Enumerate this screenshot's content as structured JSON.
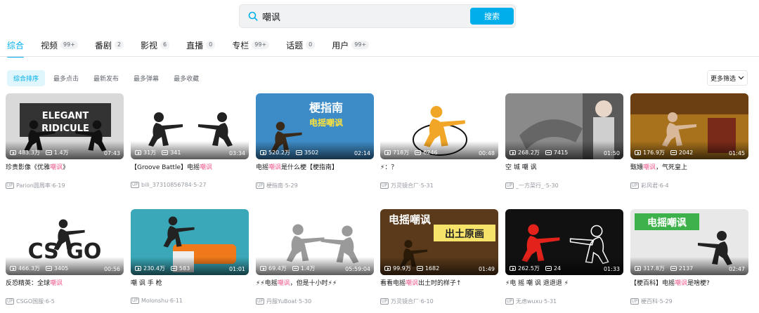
{
  "search": {
    "value": "嘲讽",
    "button_label": "搜索"
  },
  "tabs": [
    {
      "label": "综合",
      "count": null,
      "active": true
    },
    {
      "label": "视频",
      "count": "99+"
    },
    {
      "label": "番剧",
      "count": "2"
    },
    {
      "label": "影视",
      "count": "6"
    },
    {
      "label": "直播",
      "count": "0"
    },
    {
      "label": "专栏",
      "count": "99+"
    },
    {
      "label": "话题",
      "count": "0"
    },
    {
      "label": "用户",
      "count": "99+"
    }
  ],
  "sort": {
    "items": [
      "综合排序",
      "最多点击",
      "最新发布",
      "最多弹幕",
      "最多收藏"
    ],
    "more_filter": "更多筛选"
  },
  "up_badge": "UP",
  "videos": [
    {
      "views": "483.3万",
      "danmaku": "1.4万",
      "duration": "07:43",
      "title_parts": [
        "珍贵影像《优雅",
        "嘲讽",
        "》"
      ],
      "uploader": "Parion圆周率",
      "date": "6-19",
      "thumb_text": "ELEGANT RIDICULE",
      "icon": "thumb-elegant-icon"
    },
    {
      "views": "31万",
      "danmaku": "341",
      "duration": "03:34",
      "title_parts": [
        "【Groove Battle】电摇",
        "嘲讽",
        ""
      ],
      "uploader": "bili_37310856784",
      "date": "5-27",
      "thumb_text": "",
      "icon": "thumb-dancers-icon"
    },
    {
      "views": "520.2万",
      "danmaku": "3502",
      "duration": "02:14",
      "title_parts": [
        "电摇",
        "嘲讽",
        "是什么梗【梗指南】"
      ],
      "uploader": "梗指南",
      "date": "5-29",
      "thumb_text": "梗指南 电摇嘲讽",
      "icon": "thumb-guide-icon"
    },
    {
      "views": "718万",
      "danmaku": "6246",
      "duration": "00:48",
      "title_parts": [
        "⚡：？",
        "",
        ""
      ],
      "uploader": "万灵镜合厂",
      "date": "5-31",
      "thumb_text": "",
      "icon": "thumb-orange-figure-icon"
    },
    {
      "views": "268.2万",
      "danmaku": "7415",
      "duration": "01:50",
      "title_parts": [
        "空 城 嘲 讽",
        "",
        ""
      ],
      "uploader": "_一方菜行_",
      "date": "5-30",
      "thumb_text": "",
      "icon": "thumb-drama-icon"
    },
    {
      "views": "176.9万",
      "danmaku": "2042",
      "duration": "01:45",
      "title_parts": [
        "甄嬛",
        "嘲讽",
        "，气死皇上"
      ],
      "uploader": "彩风君",
      "date": "6-4",
      "thumb_text": "",
      "icon": "thumb-palace-icon"
    },
    {
      "views": "466.3万",
      "danmaku": "3405",
      "duration": "00:56",
      "title_parts": [
        "反恐精英：全球",
        "嘲讽",
        ""
      ],
      "uploader": "CSGO国服",
      "date": "6-5",
      "thumb_text": "CS GO",
      "icon": "thumb-csgo-icon"
    },
    {
      "views": "230.4万",
      "danmaku": "583",
      "duration": "01:01",
      "title_parts": [
        "嘲 讽 手 枪",
        "",
        ""
      ],
      "uploader": "Molonshu",
      "date": "6-11",
      "thumb_text": "",
      "icon": "thumb-toy-gun-icon"
    },
    {
      "views": "69.4万",
      "danmaku": "1.4万",
      "duration": "05:59:04",
      "title_parts": [
        "⚡⚡电摇",
        "嘲讽",
        "，但是十小时⚡⚡"
      ],
      "uploader": "丹服YuBoat",
      "date": "5-30",
      "thumb_text": "",
      "icon": "thumb-blur-icon"
    },
    {
      "views": "99.9万",
      "danmaku": "1682",
      "duration": "01:49",
      "title_parts": [
        "看看电摇",
        "嘲讽",
        "出土时的样子↑"
      ],
      "uploader": "万灵镜合厂",
      "date": "6-10",
      "thumb_text": "电摇嘲讽 出土原画",
      "icon": "thumb-ancient-icon"
    },
    {
      "views": "262.5万",
      "danmaku": "24",
      "duration": "01:33",
      "title_parts": [
        "⚡电 摇 嘲 讽 退退退 ⚡",
        "",
        ""
      ],
      "uploader": "无虑wuxu",
      "date": "5-31",
      "thumb_text": "",
      "icon": "thumb-red-figure-icon"
    },
    {
      "views": "317.8万",
      "danmaku": "2137",
      "duration": "02:47",
      "title_parts": [
        "【梗百科】电摇",
        "嘲讽",
        "是啥梗?"
      ],
      "uploader": "梗百科",
      "date": "5-29",
      "thumb_text": "电摇嘲讽",
      "icon": "thumb-baike-icon"
    }
  ]
}
